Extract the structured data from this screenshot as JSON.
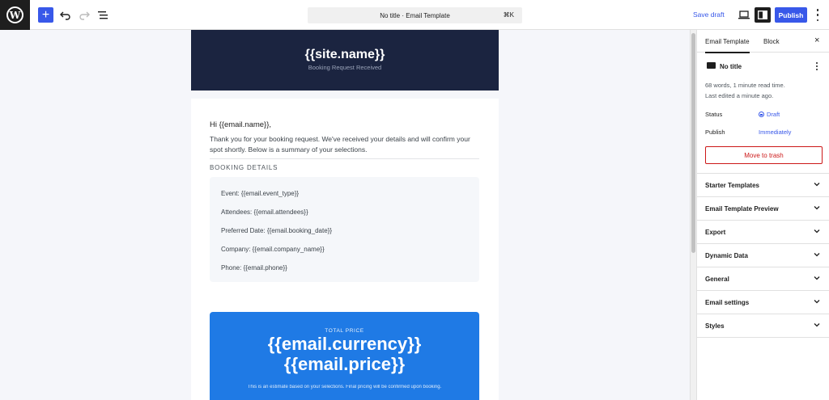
{
  "toolbar": {
    "document_title": "No title · Email Template",
    "shortcut": "⌘K",
    "save_draft": "Save draft",
    "publish": "Publish",
    "add_icon": "+",
    "icons": [
      "wordpress-logo-icon",
      "plus-icon",
      "undo-icon",
      "redo-icon",
      "list-view-icon",
      "desktop-view-icon",
      "settings-icon",
      "options-icon"
    ]
  },
  "email": {
    "site_name": "{{site.name}}",
    "header_subtitle": "Booking Request Received",
    "greeting": "Hi {{email.name}},",
    "intro": "Thank you for your booking request. We've received your details and will confirm your spot shortly. Below is a summary of your selections.",
    "details_heading": "BOOKING DETAILS",
    "details": [
      "Event: {{email.event_type}}",
      "Attendees: {{email.attendees}}",
      "Preferred Date: {{email.booking_date}}",
      "Company: {{email.company_name}}",
      "Phone: {{email.phone}}"
    ],
    "price_label": "TOTAL PRICE",
    "price_line1": "{{email.currency}}",
    "price_line2": "{{email.price}}",
    "price_note": "This is an estimate based on your selections. Final pricing will be confirmed upon booking."
  },
  "sidebar": {
    "tabs": [
      "Email Template",
      "Block"
    ],
    "close_icon": "×",
    "doc_title": "No title",
    "meta_words": "68 words, 1 minute read time.",
    "meta_edited": "Last edited a minute ago.",
    "status_label": "Status",
    "status_value": "Draft",
    "publish_label": "Publish",
    "publish_value": "Immediately",
    "trash": "Move to trash",
    "panels": [
      "Starter Templates",
      "Email Template Preview",
      "Export",
      "Dynamic Data",
      "General",
      "Email settings",
      "Styles"
    ]
  },
  "colors": {
    "accent": "#3858e9",
    "header_bg": "#1b2440",
    "price_bg": "#1f7ae5",
    "danger": "#cc1818"
  }
}
